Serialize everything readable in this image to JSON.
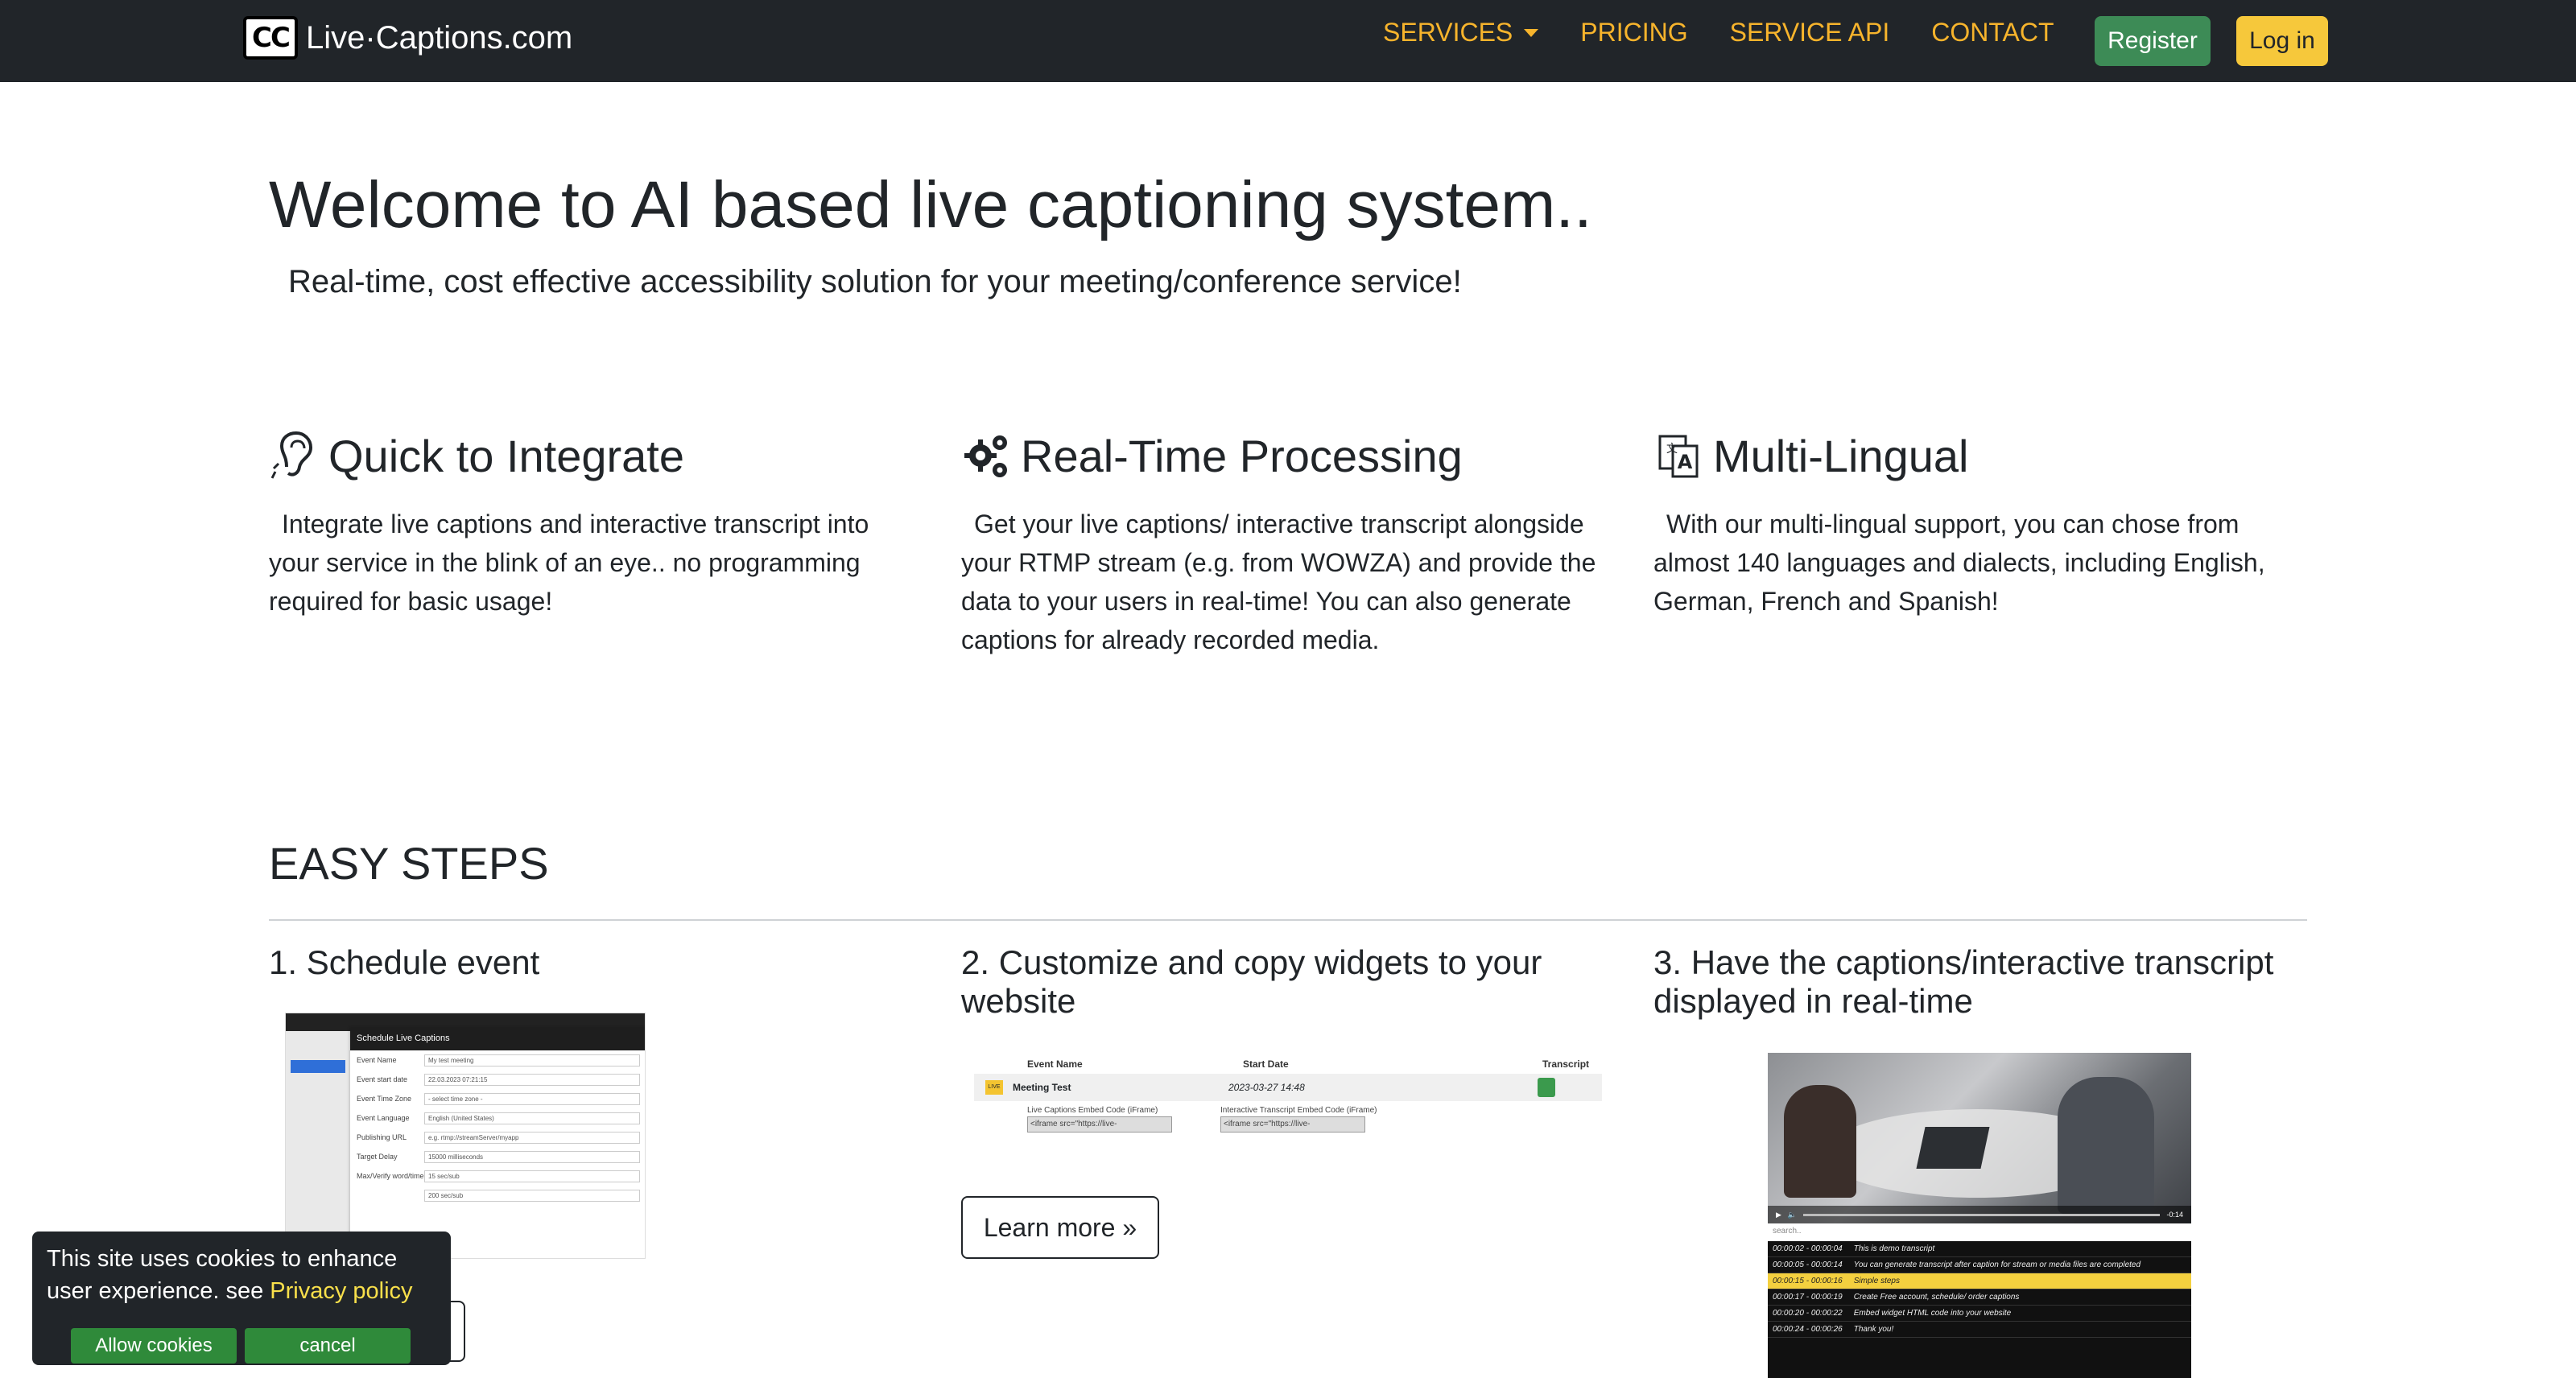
{
  "navbar": {
    "brand_logo": "CC",
    "brand_text": "Live·Captions.com",
    "links": [
      {
        "label": "SERVICES",
        "dropdown": true
      },
      {
        "label": "PRICING"
      },
      {
        "label": "SERVICE API"
      },
      {
        "label": "CONTACT"
      }
    ],
    "register_label": "Register",
    "login_label": "Log in"
  },
  "hero": {
    "title": "Welcome to AI based live captioning system..",
    "subtitle": "Real-time, cost effective accessibility solution for your meeting/conference service!"
  },
  "features": [
    {
      "icon": "ear-icon",
      "title": "Quick to Integrate",
      "text": "Integrate live captions and interactive transcript into your service in the blink of an eye.. no programming required for basic usage!"
    },
    {
      "icon": "gears-icon",
      "title": "Real-Time Processing",
      "text": "Get your live captions/ interactive transcript alongside your RTMP stream (e.g. from WOWZA) and provide the data to your users in real-time! You can also generate captions for already recorded media."
    },
    {
      "icon": "translate-icon",
      "title": "Multi-Lingual",
      "text": "With our multi-lingual support, you can chose from almost 140 languages and dialects, including English, German, French and Spanish!"
    }
  ],
  "steps": {
    "title": "EASY STEPS",
    "items": [
      {
        "title": "1. Schedule event"
      },
      {
        "title": "2. Customize and copy widgets to your website"
      },
      {
        "title": "3. Have the captions/interactive transcript displayed in real-time"
      }
    ],
    "learn_more_label": "Learn more »"
  },
  "shot1": {
    "modal_title": "Schedule Live Captions",
    "rows": [
      {
        "k": "Event Name",
        "v": "My test meeting"
      },
      {
        "k": "Event start date",
        "v": "22.03.2023 07:21:15"
      },
      {
        "k": "Event Time Zone",
        "v": "- select time zone -"
      },
      {
        "k": "Event Language",
        "v": "English (United States)"
      },
      {
        "k": "Publishing URL",
        "v": "e.g. rtmp://streamServer/myapp"
      },
      {
        "k": "Target Delay",
        "v": "15000  milliseconds"
      },
      {
        "k": "Max/Verify word/time",
        "v": "15  sec/sub"
      },
      {
        "k": "",
        "v": "200  sec/sub"
      }
    ]
  },
  "shot2": {
    "headers": [
      "Event Name",
      "Start Date",
      "Transcript"
    ],
    "live_badge": "LIVE",
    "event_name": "Meeting Test",
    "start_date": "2023-03-27 14:48",
    "embed1_label": "Live Captions Embed Code (iFrame)",
    "embed1_value": "<iframe src=\"https://live-",
    "embed2_label": "Interactive Transcript Embed Code (iFrame)",
    "embed2_value": "<iframe src=\"https://live-"
  },
  "shot3": {
    "time": "-0:14",
    "search_placeholder": "search..",
    "lines": [
      {
        "ts": "00:00:02 - 00:00:04",
        "text": "This is demo transcript",
        "hl": false
      },
      {
        "ts": "00:00:05 - 00:00:14",
        "text": "You can generate transcript after caption for stream or media files are completed",
        "hl": false
      },
      {
        "ts": "00:00:15 - 00:00:16",
        "text": "Simple steps",
        "hl": true
      },
      {
        "ts": "00:00:17 - 00:00:19",
        "text": "Create Free account, schedule/ order captions",
        "hl": false
      },
      {
        "ts": "00:00:20 - 00:00:22",
        "text": "Embed widget HTML code into your website",
        "hl": false
      },
      {
        "ts": "00:00:24 - 00:00:26",
        "text": "Thank you!",
        "hl": false
      }
    ]
  },
  "cookie": {
    "message": "This site uses cookies to enhance user experience. see ",
    "link": "Privacy policy",
    "allow_label": "Allow cookies",
    "cancel_label": "cancel"
  },
  "colors": {
    "navbar_bg": "#212529",
    "nav_link": "#f7b42c",
    "register_bg": "#3d8b56",
    "login_bg": "#f6c83b",
    "cookie_btn": "#2f8a3a",
    "cookie_link": "#f9e04b"
  }
}
